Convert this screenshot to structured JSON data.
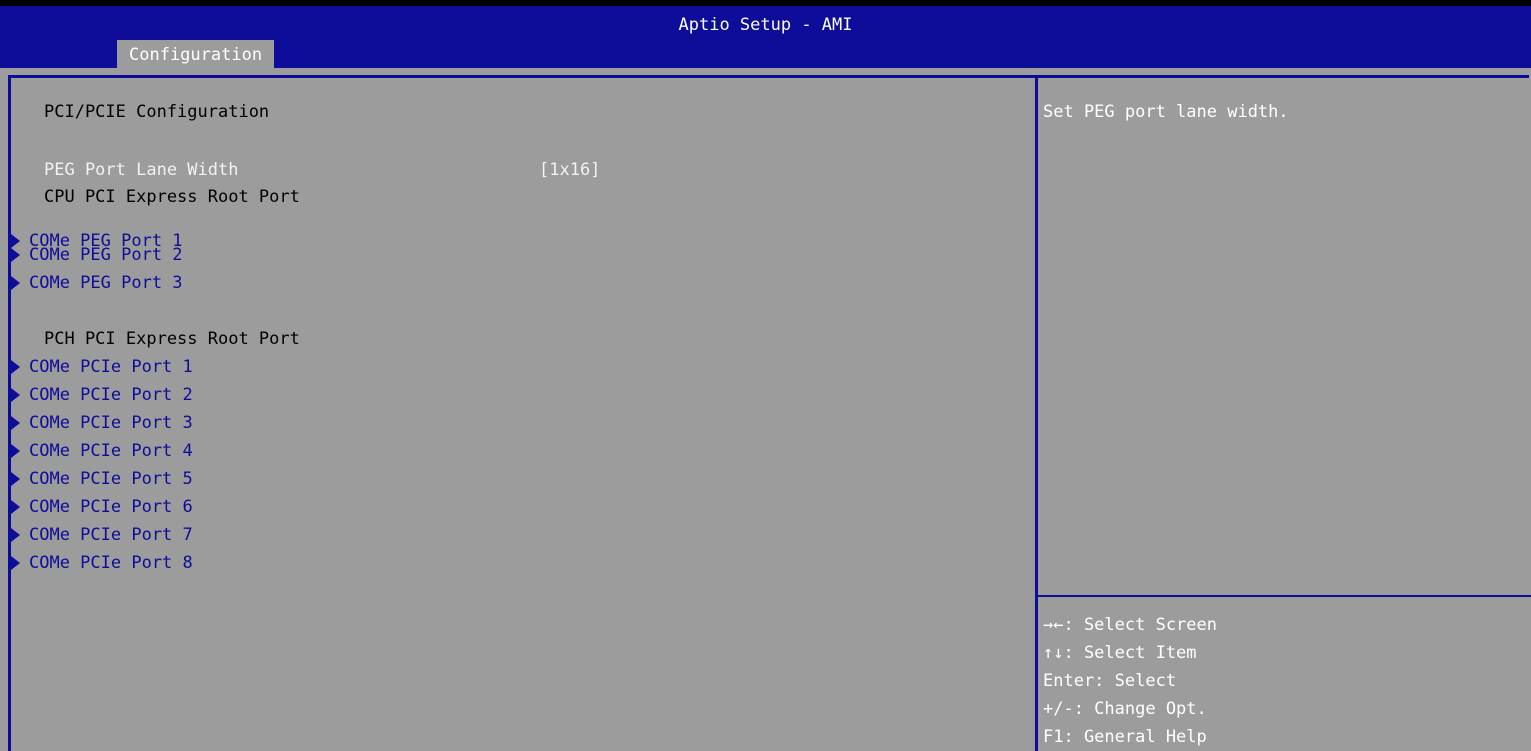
{
  "header": {
    "title": "Aptio Setup - AMI",
    "tab": "Configuration"
  },
  "main": {
    "section_title": "PCI/PCIE Configuration",
    "option": {
      "label": "PEG Port Lane Width",
      "value": "[1x16]"
    },
    "cpu_group_label": "CPU PCI Express Root Port",
    "cpu_ports": [
      "COMe PEG Port 1",
      "COMe PEG Port 2",
      "COMe PEG Port 3"
    ],
    "pch_group_label": "PCH PCI Express Root Port",
    "pch_ports": [
      "COMe PCIe Port 1",
      "COMe PCIe Port 2",
      "COMe PCIe Port 3",
      "COMe PCIe Port 4",
      "COMe PCIe Port 5",
      "COMe PCIe Port 6",
      "COMe PCIe Port 7",
      "COMe PCIe Port 8"
    ]
  },
  "help": {
    "description": "Set PEG port lane width.",
    "keys": [
      "→←: Select Screen",
      "↑↓: Select Item",
      "Enter: Select",
      "+/-: Change Opt.",
      "F1: General Help"
    ]
  },
  "colors": {
    "header_blue": "#0d0d9a",
    "background_gray": "#9c9c9c",
    "submenu_blue": "#0d0d9a",
    "selected_text": "#f2f2f2"
  },
  "icons": {
    "submenu": "triangle-right-icon"
  }
}
